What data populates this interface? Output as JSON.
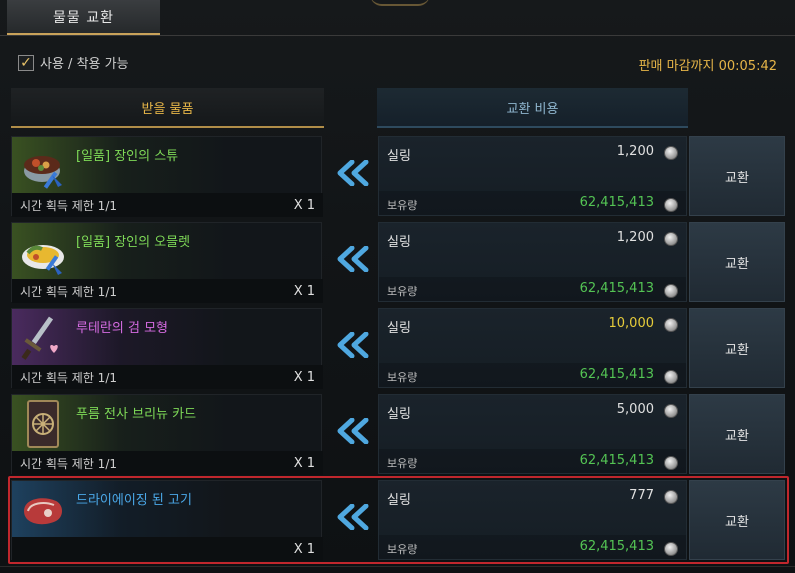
{
  "tab": {
    "label": "물물 교환"
  },
  "filter": {
    "checked": true,
    "label": "사용 / 착용 가능"
  },
  "deadline": {
    "text": "판매 마감까지 00:05:42"
  },
  "columns": {
    "receive": "받을 물품",
    "cost": "교환 비용"
  },
  "rows": [
    {
      "name": "[일품] 장인의 스튜",
      "name_color": "#7ed957",
      "glow": "green",
      "icon": "stew-pot-icon",
      "limit": "시간 획득 제한 1/1",
      "qty": "X 1",
      "currency": "실링",
      "price": "1,200",
      "price_color": "#e0e0e0",
      "owned_label": "보유량",
      "owned": "62,415,413",
      "button": "교환"
    },
    {
      "name": "[일품] 장인의 오믈렛",
      "name_color": "#7ed957",
      "glow": "green",
      "icon": "omelette-plate-icon",
      "limit": "시간 획득 제한 1/1",
      "qty": "X 1",
      "currency": "실링",
      "price": "1,200",
      "price_color": "#e0e0e0",
      "owned_label": "보유량",
      "owned": "62,415,413",
      "button": "교환"
    },
    {
      "name": "루테란의 검 모형",
      "name_color": "#d46be0",
      "glow": "purple",
      "icon": "sword-heart-icon",
      "limit": "시간 획득 제한 1/1",
      "qty": "X 1",
      "currency": "실링",
      "price": "10,000",
      "price_color": "#e6cc3a",
      "owned_label": "보유량",
      "owned": "62,415,413",
      "button": "교환"
    },
    {
      "name": "푸름 전사 브리뉴 카드",
      "name_color": "#7ed957",
      "glow": "green",
      "icon": "card-icon",
      "limit": "시간 획득 제한 1/1",
      "qty": "X 1",
      "currency": "실링",
      "price": "5,000",
      "price_color": "#e0e0e0",
      "owned_label": "보유량",
      "owned": "62,415,413",
      "button": "교환"
    },
    {
      "name": "드라이에이징 된 고기",
      "name_color": "#4aa8e8",
      "glow": "blue",
      "icon": "meat-icon",
      "limit": "",
      "qty": "X 1",
      "currency": "실링",
      "price": "777",
      "price_color": "#e0e0e0",
      "owned_label": "보유량",
      "owned": "62,415,413",
      "button": "교환",
      "selected": true
    }
  ]
}
